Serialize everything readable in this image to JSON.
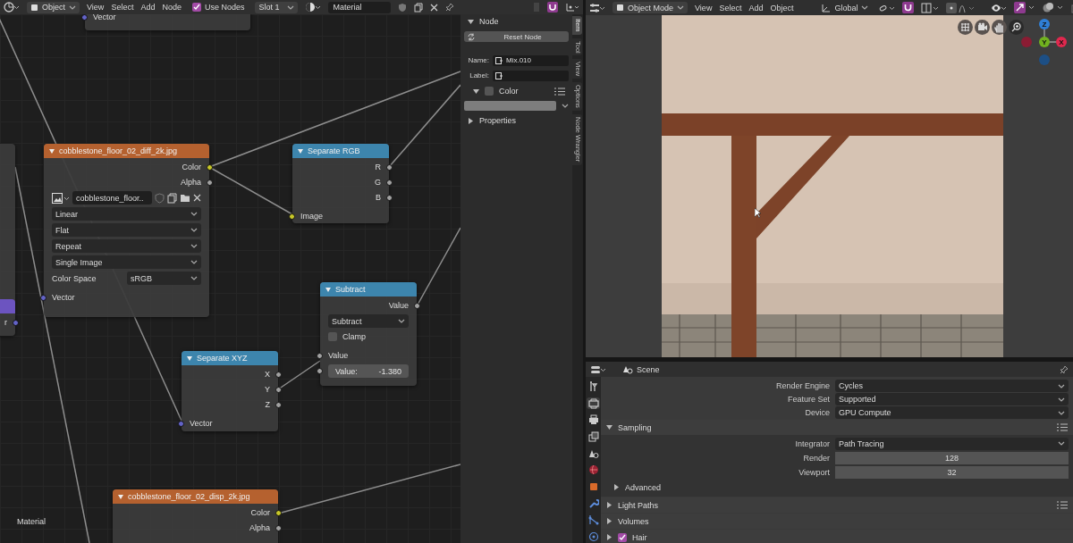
{
  "node_editor": {
    "header": {
      "object_dropdown": "Object",
      "menus": [
        "View",
        "Select",
        "Add",
        "Node"
      ],
      "use_nodes": {
        "label": "Use Nodes",
        "checked": true
      },
      "slot": "Slot 1",
      "material": "Material"
    },
    "nodes": [
      {
        "rows": [
          {
            "kind": "input",
            "label": "Vector",
            "color": "#6363c7"
          }
        ]
      },
      {
        "color": "#6c54c0",
        "rows": [
          {
            "kind": "output",
            "label": "r",
            "color": "#6363c7"
          }
        ]
      },
      {
        "title": "cobblestone_floor_02_diff_2k.jpg",
        "color": "#b5612f",
        "rows": [
          {
            "kind": "output",
            "label": "Color",
            "color": "#c7c729"
          },
          {
            "kind": "output",
            "label": "Alpha",
            "color": "#a1a1a1"
          },
          {
            "kind": "image",
            "value": "cobblestone_floor.."
          },
          {
            "kind": "dropdown",
            "value": "Linear"
          },
          {
            "kind": "dropdown",
            "value": "Flat"
          },
          {
            "kind": "dropdown",
            "value": "Repeat"
          },
          {
            "kind": "dropdown",
            "value": "Single Image"
          },
          {
            "kind": "labeled_dropdown",
            "label": "Color Space",
            "value": "sRGB"
          },
          {
            "kind": "input",
            "label": "Vector",
            "color": "#6363c7"
          }
        ]
      },
      {
        "title": "Separate RGB",
        "color": "#3d85ad",
        "rows": [
          {
            "kind": "output",
            "label": "R",
            "color": "#a1a1a1"
          },
          {
            "kind": "output",
            "label": "G",
            "color": "#a1a1a1"
          },
          {
            "kind": "output",
            "label": "B",
            "color": "#a1a1a1"
          },
          {
            "kind": "input",
            "label": "Image",
            "color": "#c7c729"
          }
        ]
      },
      {
        "title": "Subtract",
        "color": "#3d85ad",
        "rows": [
          {
            "kind": "output",
            "label": "Value",
            "color": "#a1a1a1"
          },
          {
            "kind": "dropdown",
            "value": "Subtract"
          },
          {
            "kind": "checkbox",
            "label": "Clamp",
            "checked": false
          },
          {
            "kind": "input",
            "label": "Value",
            "color": "#a1a1a1"
          },
          {
            "kind": "number",
            "label": "Value:",
            "value": "-1.380",
            "color": "#a1a1a1"
          }
        ]
      },
      {
        "title": "Separate XYZ",
        "color": "#3d85ad",
        "rows": [
          {
            "kind": "output",
            "label": "X",
            "color": "#a1a1a1"
          },
          {
            "kind": "output",
            "label": "Y",
            "color": "#a1a1a1"
          },
          {
            "kind": "output",
            "label": "Z",
            "color": "#a1a1a1"
          },
          {
            "kind": "input",
            "label": "Vector",
            "color": "#6363c7"
          }
        ]
      },
      {
        "title": "cobblestone_floor_02_disp_2k.jpg",
        "color": "#b5612f",
        "rows": [
          {
            "kind": "output",
            "label": "Color",
            "color": "#c7c729"
          },
          {
            "kind": "output",
            "label": "Alpha",
            "color": "#a1a1a1"
          }
        ]
      }
    ],
    "tree_label": "Material"
  },
  "sidebar": {
    "node_panel": {
      "title": "Node",
      "expanded": true,
      "reset_button": "Reset Node",
      "fields": [
        {
          "label": "Name:",
          "value": "Mix.010"
        },
        {
          "label": "Label:"
        }
      ],
      "color_subpanel": {
        "title": "Color",
        "expanded": true,
        "checked": false
      }
    },
    "properties_panel": {
      "title": "Properties",
      "expanded": false
    },
    "tabs": [
      {
        "label": "Item",
        "selected": true
      },
      {
        "label": "Tool",
        "selected": false
      },
      {
        "label": "View",
        "selected": false
      },
      {
        "label": "Options",
        "selected": false
      },
      {
        "label": "Node Wrangler",
        "selected": false
      }
    ]
  },
  "viewport": {
    "header": {
      "mode": "Object Mode",
      "menus": [
        "View",
        "Select",
        "Add",
        "Object"
      ],
      "orientation": "Global"
    },
    "gizmo_axes": [
      {
        "label": "Z",
        "color": "#2f7fd6"
      },
      {
        "label": "Y",
        "color": "#71b21f"
      },
      {
        "label": "X",
        "color": "#e0284e"
      }
    ]
  },
  "properties": {
    "context": "Scene",
    "tabs": [
      {
        "kind": "tool",
        "selected": false
      },
      {
        "kind": "render",
        "selected": true
      },
      {
        "kind": "output",
        "selected": false
      },
      {
        "kind": "view_layer",
        "selected": false
      },
      {
        "kind": "scene",
        "selected": false
      },
      {
        "kind": "world",
        "selected": false
      },
      {
        "kind": "object",
        "selected": false
      },
      {
        "kind": "modifier",
        "selected": false
      },
      {
        "kind": "particles",
        "selected": false
      },
      {
        "kind": "physics",
        "selected": false
      }
    ],
    "rows": [
      {
        "label": "Render Engine",
        "value": "Cycles",
        "kind": "dropdown"
      },
      {
        "label": "Feature Set",
        "value": "Supported",
        "kind": "dropdown"
      },
      {
        "label": "Device",
        "value": "GPU Compute",
        "kind": "dropdown"
      }
    ],
    "panels": [
      {
        "title": "Sampling",
        "expanded": true,
        "presets": true,
        "rows": [
          {
            "label": "Integrator",
            "value": "Path Tracing",
            "kind": "dropdown"
          },
          {
            "label": "Render",
            "value": "128",
            "kind": "number"
          },
          {
            "label": "Viewport",
            "value": "32",
            "kind": "number"
          }
        ],
        "subpanels": [
          {
            "title": "Advanced",
            "expanded": false
          }
        ]
      },
      {
        "title": "Light Paths",
        "expanded": false,
        "presets": true
      },
      {
        "title": "Volumes",
        "expanded": false
      },
      {
        "title": "Hair",
        "expanded": false,
        "checked": true
      }
    ]
  }
}
